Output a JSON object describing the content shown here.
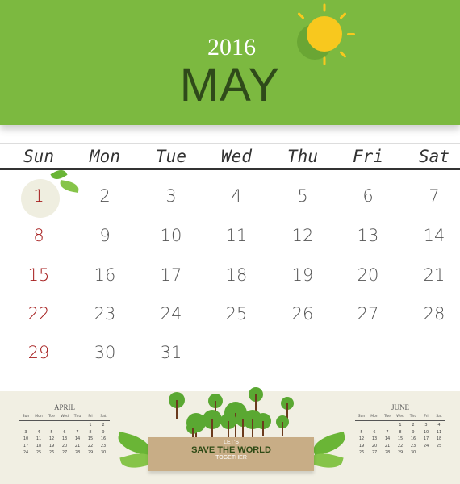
{
  "header": {
    "year": "2016",
    "month": "MAY"
  },
  "weekdays": [
    "Sun",
    "Mon",
    "Tue",
    "Wed",
    "Thu",
    "Fri",
    "Sat"
  ],
  "main_weeks": [
    [
      "1",
      "2",
      "3",
      "4",
      "5",
      "6",
      "7"
    ],
    [
      "8",
      "9",
      "10",
      "11",
      "12",
      "13",
      "14"
    ],
    [
      "15",
      "16",
      "17",
      "18",
      "19",
      "20",
      "21"
    ],
    [
      "22",
      "23",
      "24",
      "25",
      "26",
      "27",
      "28"
    ],
    [
      "29",
      "30",
      "31",
      "",
      "",
      "",
      ""
    ]
  ],
  "highlighted_day": "1",
  "colors": {
    "header_green": "#7cb940",
    "sunday_red": "#a51c1c",
    "sun_yellow": "#f8c81e",
    "bottom_bg": "#f1efe3"
  },
  "mini_calendars": [
    {
      "title": "APRIL",
      "weekdays": [
        "Sun",
        "Mon",
        "Tue",
        "Wed",
        "Thu",
        "Fri",
        "Sat"
      ],
      "weeks": [
        [
          "",
          "",
          "",
          "",
          "",
          "1",
          "2"
        ],
        [
          "3",
          "4",
          "5",
          "6",
          "7",
          "8",
          "9"
        ],
        [
          "10",
          "11",
          "12",
          "13",
          "14",
          "15",
          "16"
        ],
        [
          "17",
          "18",
          "19",
          "20",
          "21",
          "22",
          "23"
        ],
        [
          "24",
          "25",
          "26",
          "27",
          "28",
          "29",
          "30"
        ]
      ]
    },
    {
      "title": "JUNE",
      "weekdays": [
        "Sun",
        "Mon",
        "Tue",
        "Wed",
        "Thu",
        "Fri",
        "Sat"
      ],
      "weeks": [
        [
          "",
          "",
          "",
          "1",
          "2",
          "3",
          "4"
        ],
        [
          "5",
          "6",
          "7",
          "8",
          "9",
          "10",
          "11"
        ],
        [
          "12",
          "13",
          "14",
          "15",
          "16",
          "17",
          "18"
        ],
        [
          "19",
          "20",
          "21",
          "22",
          "23",
          "24",
          "25"
        ],
        [
          "26",
          "27",
          "28",
          "29",
          "30",
          "",
          ""
        ]
      ]
    }
  ],
  "banner": {
    "line1": "LET'S",
    "line2": "SAVE THE WORLD",
    "line3": "TOGETHER"
  }
}
